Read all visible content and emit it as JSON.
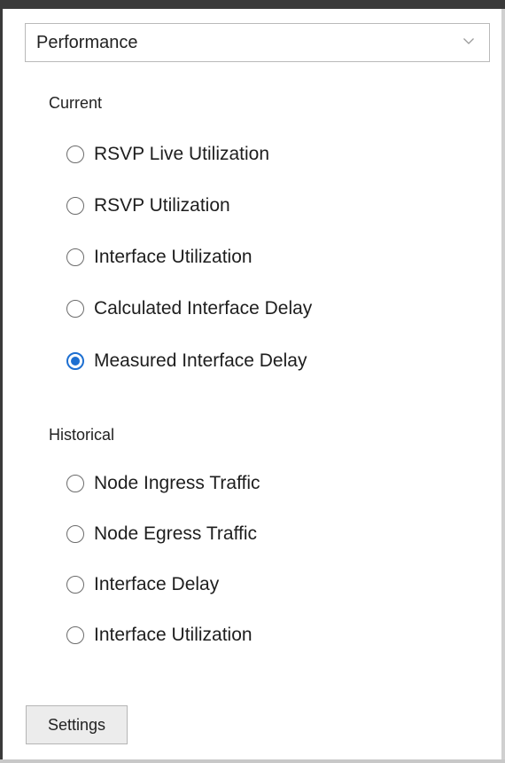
{
  "view_select": {
    "value": "Performance",
    "icon": "chevron-down-icon"
  },
  "current": {
    "heading": "Current",
    "options": [
      {
        "label": "RSVP Live Utilization",
        "checked": false
      },
      {
        "label": "RSVP Utilization",
        "checked": false
      },
      {
        "label": "Interface Utilization",
        "checked": false
      },
      {
        "label": "Calculated Interface Delay",
        "checked": false
      },
      {
        "label": "Measured Interface Delay",
        "checked": true
      }
    ]
  },
  "historical": {
    "heading": "Historical",
    "options": [
      {
        "label": "Node Ingress Traffic",
        "checked": false
      },
      {
        "label": "Node Egress Traffic",
        "checked": false
      },
      {
        "label": "Interface Delay",
        "checked": false
      },
      {
        "label": "Interface Utilization",
        "checked": false
      }
    ]
  },
  "footer": {
    "settings_label": "Settings"
  },
  "colors": {
    "accent": "#1d6fd1",
    "frame": "#3a3a3a"
  }
}
